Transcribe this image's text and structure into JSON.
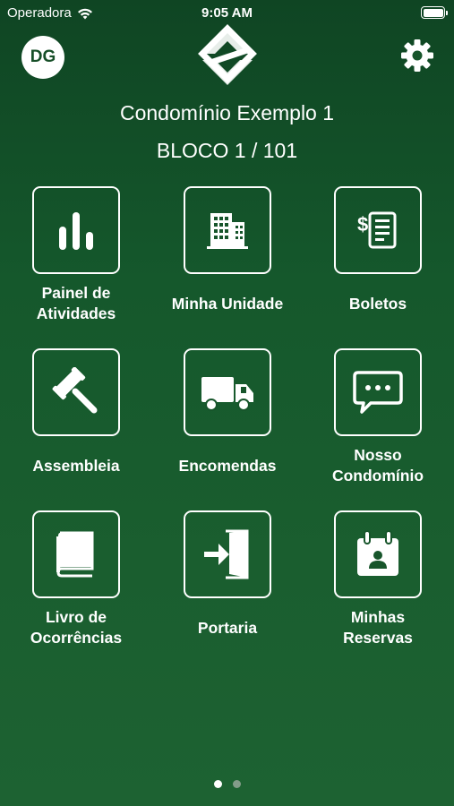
{
  "status_bar": {
    "carrier": "Operadora",
    "time": "9:05 AM"
  },
  "header": {
    "avatar_initials": "DG",
    "condo_name": "Condomínio Exemplo 1",
    "unit": "BLOCO 1 / 101"
  },
  "menu": [
    {
      "label_line1": "Painel de",
      "label_line2": "Atividades",
      "icon": "bar-chart-icon"
    },
    {
      "label_line1": "Minha Unidade",
      "label_line2": "",
      "icon": "building-icon"
    },
    {
      "label_line1": "Boletos",
      "label_line2": "",
      "icon": "invoice-icon"
    },
    {
      "label_line1": "Assembleia",
      "label_line2": "",
      "icon": "gavel-icon"
    },
    {
      "label_line1": "Encomendas",
      "label_line2": "",
      "icon": "truck-icon"
    },
    {
      "label_line1": "Nosso",
      "label_line2": "Condomínio",
      "icon": "chat-bubble-icon"
    },
    {
      "label_line1": "Livro de",
      "label_line2": "Ocorrências",
      "icon": "book-icon"
    },
    {
      "label_line1": "Portaria",
      "label_line2": "",
      "icon": "entrance-icon"
    },
    {
      "label_line1": "Minhas",
      "label_line2": "Reservas",
      "icon": "calendar-icon"
    }
  ],
  "pagination": {
    "current_page": 1,
    "total_pages": 2
  },
  "colors": {
    "background": "#15582c",
    "foreground": "#ffffff"
  }
}
